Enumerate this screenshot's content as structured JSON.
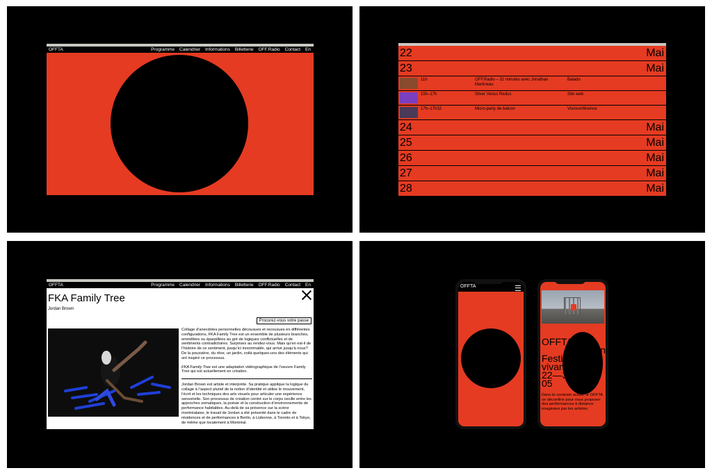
{
  "nav": {
    "logo": "OFFTA",
    "links": [
      "Programme",
      "Calendrier",
      "Informations",
      "Billetterie",
      "OFF.Radio",
      "Contact",
      "En"
    ]
  },
  "calendar": {
    "month": "Mai",
    "days_before": [
      "22",
      "23"
    ],
    "events": [
      {
        "time": "11h",
        "title": "OFF.Radio – 32 minutes avec Jonathan Martineau",
        "type": "Balado",
        "thumb_color": "#8a4a2e"
      },
      {
        "time": "15h–17h",
        "title": "Silver Venus Redux",
        "type": "Site web",
        "thumb_color": "#7a3fbf"
      },
      {
        "time": "17h–17h32",
        "title": "Micro-party de balcon",
        "type": "Visioconférence",
        "thumb_color": "#4a3a58"
      }
    ],
    "days_after": [
      "24",
      "25",
      "26",
      "27",
      "28"
    ]
  },
  "article": {
    "title": "FKA Family Tree",
    "author": "Jordan Brown",
    "pass_button": "Procurez-vous votre passe",
    "para1": "Collage d’anecdotes personnelles décousues et recousues en différentes configurations, FKA Family Tree est un ensemble de plusieurs branches, emmêlées ou éparpillées au gré de logiques conflictuelles et de sentiments contradictoires. Surprises au rendez-vous. Mais qu’en est-il de l’histoire de ce sentiment, jusqu’ici innommable, qui arrive jusqu’à nous? De la poussière, du rêve, un jardin, voilà quelques-uns des éléments qui ont inspiré ce processus.",
    "para2_italic": "FKA Family Tree",
    "para2_rest": " est une adaptation vidéographique de l’oeuvre Family Tree qui est actuellement en création.",
    "para3": "Jordan Brown est artiste et interprète. Sa pratique applique la logique du collage à l’aspect pluriel de la notion d’identité et utilise le mouvement, l’écrit et les techniques des arts visuels pour articuler une expérience sensorielle. Son processus de création centré sur le corps oscille entre les approches somatiques, la poésie et la construction d’environnements de performance habitables. Au-delà de sa présence sur la scène montréalaise, le travail de Jordan a été présenté dans le cadre de résidences et de performances à Berlin, à Lisbonne, à Toronto et à Tokyo, de même que localement à Montréal."
  },
  "mobile": {
    "logo": "OFFTA",
    "headline_lines": [
      "OFFTA  14e",
      "édition",
      "Festival d’arts",
      "vivants",
      "22—32   20",
      "05        20"
    ],
    "description": "Dans le contexte actuel, le OFFTA se déconfine pour vous proposer des performances à distance imaginées par les artistes."
  },
  "colors": {
    "accent": "#e53b22",
    "background": "#000000",
    "strip": "#c9c8c1"
  }
}
